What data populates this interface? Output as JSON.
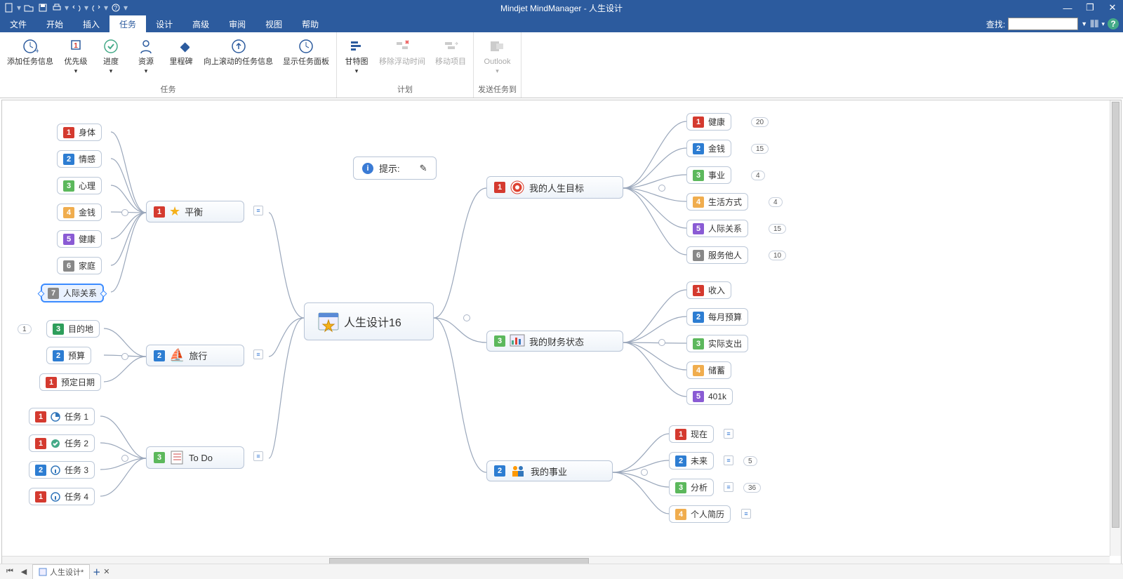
{
  "app": {
    "title": "Mindjet MindManager - 人生设计"
  },
  "qat": {
    "items": [
      "new",
      "open",
      "save",
      "print",
      "undo",
      "redo",
      "help"
    ]
  },
  "wincontrols": {
    "min": "—",
    "max": "❐",
    "close": "✕"
  },
  "menu": {
    "items": [
      "文件",
      "开始",
      "插入",
      "任务",
      "设计",
      "高级",
      "审阅",
      "视图",
      "帮助"
    ],
    "active_index": 3,
    "search_label": "查找:"
  },
  "ribbon": {
    "groups": [
      {
        "title": "任务",
        "buttons": [
          {
            "label": "添加任务信息",
            "icon": "clock-plus"
          },
          {
            "label": "优先级",
            "icon": "priority",
            "dd": true
          },
          {
            "label": "进度",
            "icon": "progress-check",
            "dd": true
          },
          {
            "label": "资源",
            "icon": "person",
            "dd": true
          },
          {
            "label": "里程碑",
            "icon": "milestone"
          },
          {
            "label": "向上滚动的任务信息",
            "icon": "rollup"
          },
          {
            "label": "显示任务面板",
            "icon": "task-panel"
          }
        ]
      },
      {
        "title": "计划",
        "buttons": [
          {
            "label": "甘特图",
            "icon": "gantt",
            "dd": true
          },
          {
            "label": "移除浮动时间",
            "icon": "remove-slack",
            "disabled": true
          },
          {
            "label": "移动项目",
            "icon": "move-project",
            "disabled": true
          }
        ]
      },
      {
        "title": "发送任务到",
        "buttons": [
          {
            "label": "Outlook",
            "icon": "outlook",
            "dd": true,
            "disabled": true
          }
        ]
      }
    ]
  },
  "tip": {
    "label": "提示:"
  },
  "center": {
    "label": "人生设计16"
  },
  "right_branches": [
    {
      "num": "1",
      "color": "nb-red",
      "icon": "target",
      "label": "我的人生目标",
      "children": [
        {
          "num": "1",
          "color": "nb-red",
          "label": "健康",
          "pill": "20"
        },
        {
          "num": "2",
          "color": "nb-blue",
          "label": "金钱",
          "pill": "15"
        },
        {
          "num": "3",
          "color": "nb-green",
          "label": "事业",
          "pill": "4"
        },
        {
          "num": "4",
          "color": "nb-yellow",
          "label": "生活方式",
          "pill": "4"
        },
        {
          "num": "5",
          "color": "nb-purple",
          "label": "人际关系",
          "pill": "15"
        },
        {
          "num": "6",
          "color": "nb-gray",
          "label": "服务他人",
          "pill": "10"
        }
      ]
    },
    {
      "num": "3",
      "color": "nb-green",
      "icon": "finance",
      "label": "我的财务状态",
      "children": [
        {
          "num": "1",
          "color": "nb-red",
          "label": "收入"
        },
        {
          "num": "2",
          "color": "nb-blue",
          "label": "每月预算"
        },
        {
          "num": "3",
          "color": "nb-green",
          "label": "实际支出"
        },
        {
          "num": "4",
          "color": "nb-yellow",
          "label": "储蓄"
        },
        {
          "num": "5",
          "color": "nb-purple",
          "label": "401k"
        }
      ]
    },
    {
      "num": "2",
      "color": "nb-blue",
      "icon": "career",
      "label": "我的事业",
      "children": [
        {
          "num": "1",
          "color": "nb-red",
          "label": "现在",
          "note": true
        },
        {
          "num": "2",
          "color": "nb-blue",
          "label": "未来",
          "note": true,
          "pill": "5"
        },
        {
          "num": "3",
          "color": "nb-green",
          "label": "分析",
          "note": true,
          "pill": "36"
        },
        {
          "num": "4",
          "color": "nb-yellow",
          "label": "个人简历",
          "note": true
        }
      ]
    }
  ],
  "left_branches": [
    {
      "num": "1",
      "color": "nb-red",
      "icon": "star",
      "label": "平衡",
      "children": [
        {
          "num": "1",
          "color": "nb-red",
          "label": "身体"
        },
        {
          "num": "2",
          "color": "nb-blue",
          "label": "情感"
        },
        {
          "num": "3",
          "color": "nb-green",
          "label": "心理"
        },
        {
          "num": "4",
          "color": "nb-yellow",
          "label": "金钱"
        },
        {
          "num": "5",
          "color": "nb-purple",
          "label": "健康"
        },
        {
          "num": "6",
          "color": "nb-gray",
          "label": "家庭"
        },
        {
          "num": "7",
          "color": "nb-gray",
          "label": "人际关系",
          "selected": true
        }
      ]
    },
    {
      "num": "2",
      "color": "nb-blue",
      "icon": "boat",
      "label": "旅行",
      "children": [
        {
          "num": "3",
          "color": "nb-darkgreen",
          "label": "目的地",
          "pill_left": "1"
        },
        {
          "num": "2",
          "color": "nb-blue",
          "label": "预算"
        },
        {
          "num": "1",
          "color": "nb-red",
          "label": "预定日期"
        }
      ]
    },
    {
      "num": "3",
      "color": "nb-green",
      "icon": "todo",
      "label": "To Do",
      "children": [
        {
          "num": "1",
          "color": "nb-red",
          "label": "任务 1",
          "status": "pie"
        },
        {
          "num": "1",
          "color": "nb-red",
          "label": "任务 2",
          "status": "check"
        },
        {
          "num": "2",
          "color": "nb-blue",
          "label": "任务 3",
          "status": "info"
        },
        {
          "num": "1",
          "color": "nb-red",
          "label": "任务 4",
          "status": "info"
        }
      ]
    }
  ],
  "tab": {
    "label": "人生设计*"
  }
}
